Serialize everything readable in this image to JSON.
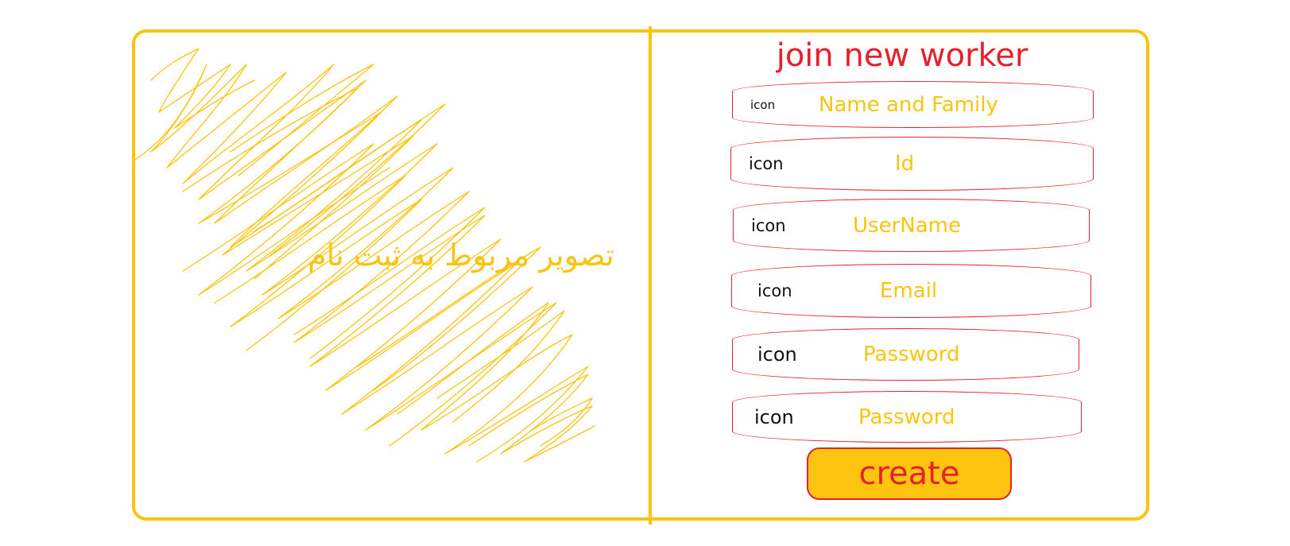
{
  "left_panel": {
    "caption": "تصویر مربوط به ثبت نام"
  },
  "form": {
    "title": "join new worker",
    "fields": [
      {
        "icon": "icon",
        "label": "Name and Family"
      },
      {
        "icon": "icon",
        "label": "Id"
      },
      {
        "icon": "icon",
        "label": "UserName"
      },
      {
        "icon": "icon",
        "label": "Email"
      },
      {
        "icon": "icon",
        "label": "Password"
      },
      {
        "icon": "icon",
        "label": "Password"
      }
    ],
    "create_label": "create"
  },
  "colors": {
    "accent_yellow": "#FCC40E",
    "accent_red": "#E8202B"
  }
}
